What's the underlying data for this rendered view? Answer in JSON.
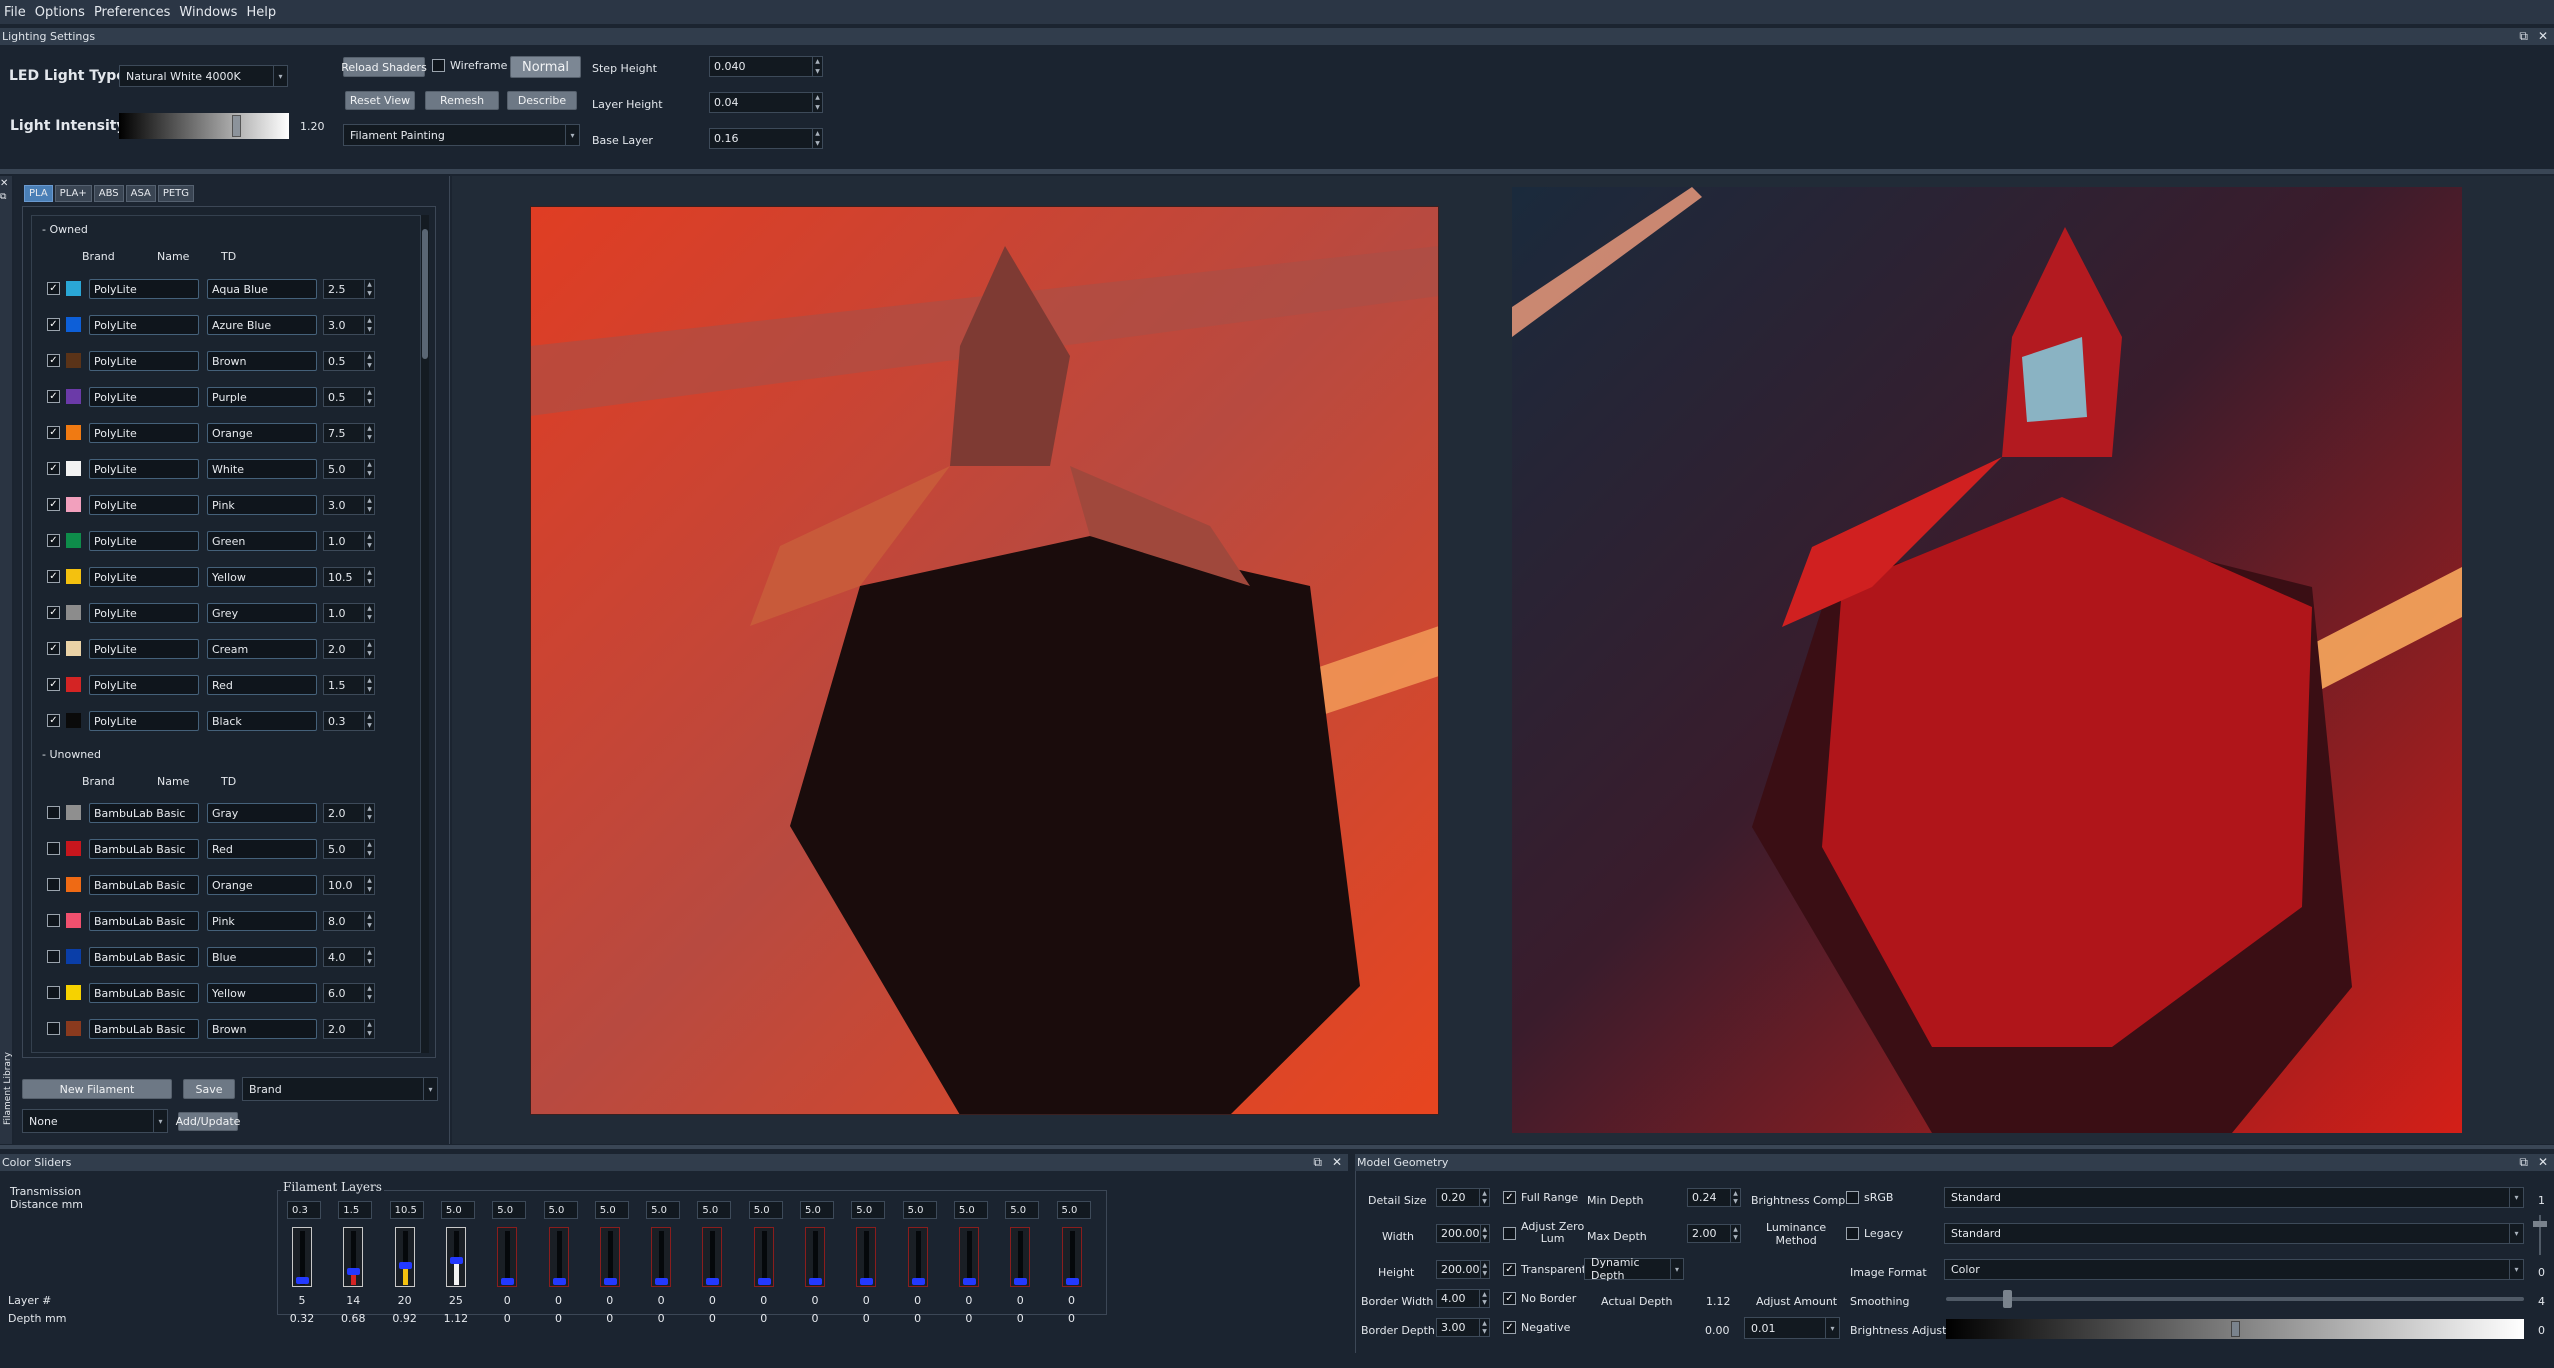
{
  "menu": [
    "File",
    "Options",
    "Preferences",
    "Windows",
    "Help"
  ],
  "lighting": {
    "title": "Lighting Settings",
    "led_label": "LED Light Type",
    "led_value": "Natural White 4000K",
    "intensity_label": "Light Intensity",
    "intensity_value": "1.20",
    "intensity_level": 0.7,
    "reload_shaders": "Reload Shaders",
    "wireframe": "Wireframe",
    "normal": "Normal",
    "reset_view": "Reset View",
    "remesh": "Remesh",
    "describe": "Describe",
    "mode_value": "Filament Painting",
    "step_height_label": "Step Height",
    "step_height": "0.040",
    "layer_height_label": "Layer Height",
    "layer_height": "0.04",
    "base_layer_label": "Base Layer",
    "base_layer": "0.16"
  },
  "library": {
    "side_title": "Filament Library",
    "tabs": [
      "PLA",
      "PLA+",
      "ABS",
      "ASA",
      "PETG"
    ],
    "owned_header": "- Owned",
    "unowned_header": "- Unowned",
    "col_brand": "Brand",
    "col_name": "Name",
    "col_td": "TD",
    "owned": [
      {
        "brand": "PolyLite",
        "name": "Aqua Blue",
        "td": "2.5",
        "color": "#2aa7d6"
      },
      {
        "brand": "PolyLite",
        "name": "Azure Blue",
        "td": "3.0",
        "color": "#0d5fd8"
      },
      {
        "brand": "PolyLite",
        "name": "Brown",
        "td": "0.5",
        "color": "#5a3318"
      },
      {
        "brand": "PolyLite",
        "name": "Purple",
        "td": "0.5",
        "color": "#6b3aa8"
      },
      {
        "brand": "PolyLite",
        "name": "Orange",
        "td": "7.5",
        "color": "#f07a12"
      },
      {
        "brand": "PolyLite",
        "name": "White",
        "td": "5.0",
        "color": "#f2f2f2"
      },
      {
        "brand": "PolyLite",
        "name": "Pink",
        "td": "3.0",
        "color": "#f2a0bd"
      },
      {
        "brand": "PolyLite",
        "name": "Green",
        "td": "1.0",
        "color": "#0e8c4a"
      },
      {
        "brand": "PolyLite",
        "name": "Yellow",
        "td": "10.5",
        "color": "#f4c10f"
      },
      {
        "brand": "PolyLite",
        "name": "Grey",
        "td": "1.0",
        "color": "#8c8c8c"
      },
      {
        "brand": "PolyLite",
        "name": "Cream",
        "td": "2.0",
        "color": "#ead2a6"
      },
      {
        "brand": "PolyLite",
        "name": "Red",
        "td": "1.5",
        "color": "#d42424"
      },
      {
        "brand": "PolyLite",
        "name": "Black",
        "td": "0.3",
        "color": "#0a0a0a"
      }
    ],
    "unowned": [
      {
        "brand": "BambuLab Basic",
        "name": "Gray",
        "td": "2.0",
        "color": "#8f8f8f"
      },
      {
        "brand": "BambuLab Basic",
        "name": "Red",
        "td": "5.0",
        "color": "#c8161d"
      },
      {
        "brand": "BambuLab Basic",
        "name": "Orange",
        "td": "10.0",
        "color": "#ef6a14"
      },
      {
        "brand": "BambuLab Basic",
        "name": "Pink",
        "td": "8.0",
        "color": "#f0506e"
      },
      {
        "brand": "BambuLab Basic",
        "name": "Blue",
        "td": "4.0",
        "color": "#0a3ea8"
      },
      {
        "brand": "BambuLab Basic",
        "name": "Yellow",
        "td": "6.0",
        "color": "#f6d200"
      },
      {
        "brand": "BambuLab Basic",
        "name": "Brown",
        "td": "2.0",
        "color": "#8a3a1e"
      }
    ],
    "new_filament": "New Filament",
    "save": "Save",
    "sort_value": "Brand",
    "filter_value": "None",
    "add_update": "Add/Update"
  },
  "color_sliders": {
    "title": "Color Sliders",
    "trans_label_1": "Transmission",
    "trans_label_2": "Distance mm",
    "layer_label": "Layer #",
    "depth_label": "Depth mm",
    "group_title": "Filament Layers",
    "slots": [
      {
        "td": "0.3",
        "layer": "5",
        "depth": "0.32",
        "level": 0.08,
        "color": "#111111",
        "active": true
      },
      {
        "td": "1.5",
        "layer": "14",
        "depth": "0.68",
        "level": 0.25,
        "color": "#d42424",
        "active": true
      },
      {
        "td": "10.5",
        "layer": "20",
        "depth": "0.92",
        "level": 0.35,
        "color": "#f4c10f",
        "active": true
      },
      {
        "td": "5.0",
        "layer": "25",
        "depth": "1.12",
        "level": 0.45,
        "color": "#f2f2f2",
        "active": true
      },
      {
        "td": "5.0",
        "layer": "0",
        "depth": "0",
        "level": 0,
        "color": "#000000",
        "active": false
      },
      {
        "td": "5.0",
        "layer": "0",
        "depth": "0",
        "level": 0,
        "color": "#000000",
        "active": false
      },
      {
        "td": "5.0",
        "layer": "0",
        "depth": "0",
        "level": 0,
        "color": "#000000",
        "active": false
      },
      {
        "td": "5.0",
        "layer": "0",
        "depth": "0",
        "level": 0,
        "color": "#000000",
        "active": false
      },
      {
        "td": "5.0",
        "layer": "0",
        "depth": "0",
        "level": 0,
        "color": "#000000",
        "active": false
      },
      {
        "td": "5.0",
        "layer": "0",
        "depth": "0",
        "level": 0,
        "color": "#000000",
        "active": false
      },
      {
        "td": "5.0",
        "layer": "0",
        "depth": "0",
        "level": 0,
        "color": "#000000",
        "active": false
      },
      {
        "td": "5.0",
        "layer": "0",
        "depth": "0",
        "level": 0,
        "color": "#000000",
        "active": false
      },
      {
        "td": "5.0",
        "layer": "0",
        "depth": "0",
        "level": 0,
        "color": "#000000",
        "active": false
      },
      {
        "td": "5.0",
        "layer": "0",
        "depth": "0",
        "level": 0,
        "color": "#000000",
        "active": false
      },
      {
        "td": "5.0",
        "layer": "0",
        "depth": "0",
        "level": 0,
        "color": "#000000",
        "active": false
      },
      {
        "td": "5.0",
        "layer": "0",
        "depth": "0",
        "level": 0,
        "color": "#000000",
        "active": false
      }
    ]
  },
  "geometry": {
    "title": "Model Geometry",
    "detail_size_label": "Detail Size",
    "detail_size": "0.20",
    "width_label": "Width",
    "width": "200.00",
    "height_label": "Height",
    "height": "200.00",
    "border_width_label": "Border Width",
    "border_width": "4.00",
    "border_depth_label": "Border Depth",
    "border_depth": "3.00",
    "full_range": "Full Range",
    "adjust_zero_1": "Adjust Zero",
    "adjust_zero_2": "Lum",
    "transparent": "Transparent",
    "no_border": "No Border",
    "negative": "Negative",
    "min_depth_label": "Min Depth",
    "min_depth": "0.24",
    "max_depth_label": "Max Depth",
    "max_depth": "2.00",
    "dynamic_depth": "Dynamic Depth",
    "actual_depth_label": "Actual Depth",
    "actual_depth": "1.12",
    "neg_value": "0.00",
    "brightness_comp": "Brightness Comp",
    "lum_method_1": "Luminance",
    "lum_method_2": "Method",
    "adjust_amount_label": "Adjust Amount",
    "adjust_amount": "0.01",
    "srgb": "sRGB",
    "legacy": "Legacy",
    "image_format_label": "Image Format",
    "smoothing_label": "Smoothing",
    "brightness_adjust_label": "Brightness Adjust",
    "combo1": "Standard",
    "combo2": "Standard",
    "combo3": "Color",
    "val1": "1",
    "val2": "0",
    "val3": "0",
    "smoothing_val": "4",
    "brightness_val": "0",
    "smoothing_level": 0.1,
    "brightness_level": 0.5
  }
}
